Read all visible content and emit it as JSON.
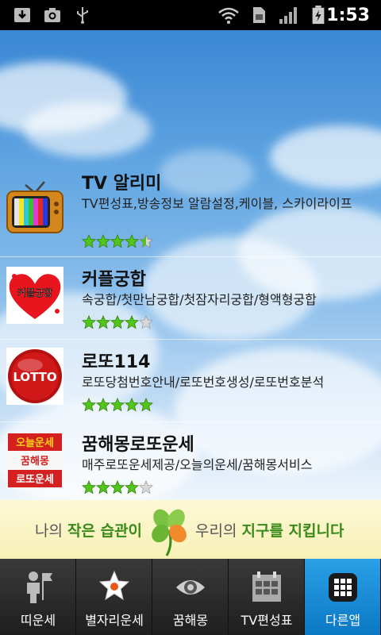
{
  "status_bar": {
    "time": "1:53",
    "icons": [
      "download-icon",
      "camera-icon",
      "usb-icon",
      "wifi-icon",
      "sim-icon",
      "signal-icon",
      "battery-charging-icon"
    ]
  },
  "apps": [
    {
      "name": "TV 알리미",
      "desc": "TV편성표,방송정보 알람설정,케이블, 스카이라이프",
      "rating": 4.5,
      "icon": "tv-icon"
    },
    {
      "name": "커플궁합",
      "desc": "속궁합/첫만남궁합/첫잠자리궁합/형액형궁합",
      "rating": 4,
      "icon": "couple-heart-icon",
      "icon_text": "커플궁합"
    },
    {
      "name": "로또114",
      "desc": "로또당첨번호안내/로또번호생성/로또번호분석",
      "rating": 5,
      "icon": "lotto-icon",
      "icon_text": "LOTTO"
    },
    {
      "name": "꿈해몽로또운세",
      "desc": "매주로또운세제공/오늘의운세/꿈해몽서비스",
      "rating": 4,
      "icon": "dream-lotto-icon",
      "icon_lines": [
        "오늘운세",
        "꿈해몽",
        "로또운세"
      ]
    }
  ],
  "banner": {
    "part1": "나의 ",
    "hl1": "작은 습관이",
    "part2": "우리의 ",
    "hl2": "지구를 지킵니다",
    "icon": "clover-icon"
  },
  "tabs": [
    {
      "label": "띠운세",
      "icon": "zodiac-person-icon",
      "active": false
    },
    {
      "label": "별자리운세",
      "icon": "star-icon",
      "active": false
    },
    {
      "label": "꿈해몽",
      "icon": "eye-icon",
      "active": false
    },
    {
      "label": "TV편성표",
      "icon": "calendar-icon",
      "active": false
    },
    {
      "label": "다른앱",
      "icon": "grid-icon",
      "active": true
    }
  ],
  "colors": {
    "status_bg": "#000000",
    "tab_active": "#1a8fd8",
    "banner_highlight": "#3a8a1a"
  }
}
